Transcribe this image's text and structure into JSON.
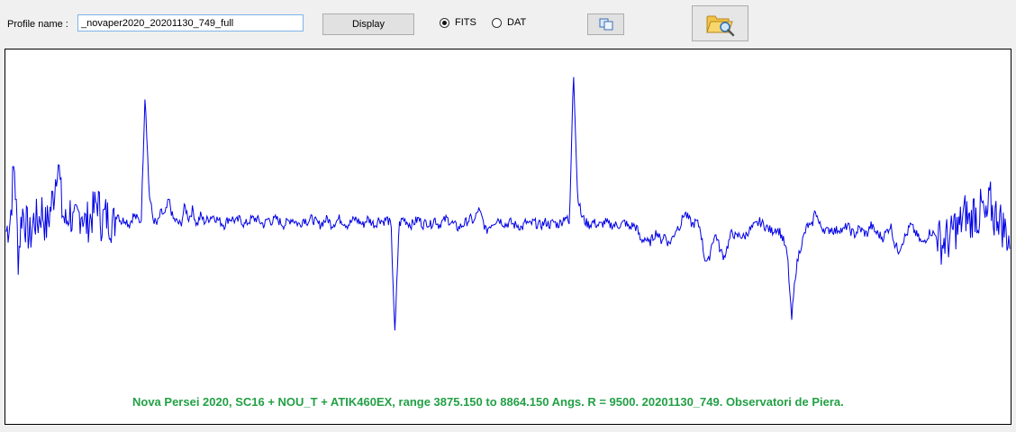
{
  "toolbar": {
    "profile_label": "Profile name :",
    "profile_value": "_novaper2020_20201130_749_full",
    "display_label": "Display",
    "format_options": [
      {
        "label": "FITS",
        "selected": true
      },
      {
        "label": "DAT",
        "selected": false
      }
    ],
    "copy_icon": "copy-icon",
    "open_icon": "folder-search-icon"
  },
  "plot": {
    "caption": "Nova Persei 2020, SC16 + NOU_T + ATIK460EX, range  3875.150  to  8864.150  Angs.   R = 9500.  20201130_749.   Observatori de Piera.",
    "line_color": "#0000e6",
    "caption_color": "#22a045"
  },
  "chart_data": {
    "type": "line",
    "x_range": [
      3875.15,
      8864.15
    ],
    "x_unit": "Angs.",
    "series": [
      {
        "normalized_flux": [
          0.48,
          0.52,
          0.7,
          0.4,
          0.55,
          0.5,
          0.46,
          0.52,
          0.51,
          0.55,
          0.49,
          0.54,
          0.6,
          0.72,
          0.55,
          0.5,
          0.55,
          0.49,
          0.52,
          0.55,
          0.5,
          0.52,
          0.54,
          0.58,
          0.51,
          0.53,
          0.52,
          0.5,
          0.54,
          0.51,
          0.52,
          0.5,
          0.53,
          0.52,
          0.51,
          0.92,
          0.6,
          0.52,
          0.5,
          0.54,
          0.53,
          0.58,
          0.52,
          0.51,
          0.5,
          0.56,
          0.52,
          0.55,
          0.5,
          0.53,
          0.51,
          0.52,
          0.53,
          0.52,
          0.51,
          0.5,
          0.52,
          0.52,
          0.51,
          0.52,
          0.5,
          0.51,
          0.52,
          0.52,
          0.51,
          0.5,
          0.52,
          0.51,
          0.52,
          0.51,
          0.5,
          0.51,
          0.52,
          0.51,
          0.5,
          0.52,
          0.51,
          0.52,
          0.51,
          0.5,
          0.51,
          0.52,
          0.5,
          0.51,
          0.52,
          0.51,
          0.5,
          0.51,
          0.52,
          0.51,
          0.5,
          0.52,
          0.51,
          0.5,
          0.52,
          0.51,
          0.52,
          0.5,
          0.15,
          0.5,
          0.52,
          0.51,
          0.5,
          0.51,
          0.52,
          0.5,
          0.51,
          0.5,
          0.52,
          0.5,
          0.51,
          0.52,
          0.51,
          0.5,
          0.49,
          0.5,
          0.51,
          0.52,
          0.51,
          0.55,
          0.52,
          0.48,
          0.5,
          0.51,
          0.52,
          0.51,
          0.5,
          0.51,
          0.5,
          0.5,
          0.49,
          0.51,
          0.5,
          0.51,
          0.5,
          0.5,
          0.51,
          0.5,
          0.51,
          0.5,
          0.51,
          0.53,
          0.5,
          1.0,
          0.6,
          0.53,
          0.51,
          0.5,
          0.51,
          0.5,
          0.5,
          0.51,
          0.5,
          0.5,
          0.5,
          0.5,
          0.51,
          0.49,
          0.5,
          0.49,
          0.45,
          0.46,
          0.44,
          0.46,
          0.48,
          0.45,
          0.47,
          0.44,
          0.46,
          0.49,
          0.5,
          0.54,
          0.52,
          0.5,
          0.51,
          0.49,
          0.4,
          0.38,
          0.45,
          0.47,
          0.42,
          0.4,
          0.44,
          0.48,
          0.46,
          0.47,
          0.46,
          0.48,
          0.49,
          0.5,
          0.51,
          0.5,
          0.49,
          0.48,
          0.49,
          0.48,
          0.45,
          0.4,
          0.2,
          0.35,
          0.42,
          0.46,
          0.5,
          0.49,
          0.55,
          0.5,
          0.49,
          0.48,
          0.49,
          0.48,
          0.49,
          0.48,
          0.5,
          0.48,
          0.47,
          0.49,
          0.48,
          0.47,
          0.5,
          0.48,
          0.47,
          0.46,
          0.48,
          0.5,
          0.44,
          0.42,
          0.45,
          0.47,
          0.5,
          0.48,
          0.46,
          0.44,
          0.46,
          0.48,
          0.47,
          0.46,
          0.44,
          0.46,
          0.45,
          0.5,
          0.48,
          0.52,
          0.54,
          0.5,
          0.55,
          0.52,
          0.56,
          0.5,
          0.58,
          0.52,
          0.54,
          0.5,
          0.48,
          0.45
        ]
      }
    ]
  }
}
